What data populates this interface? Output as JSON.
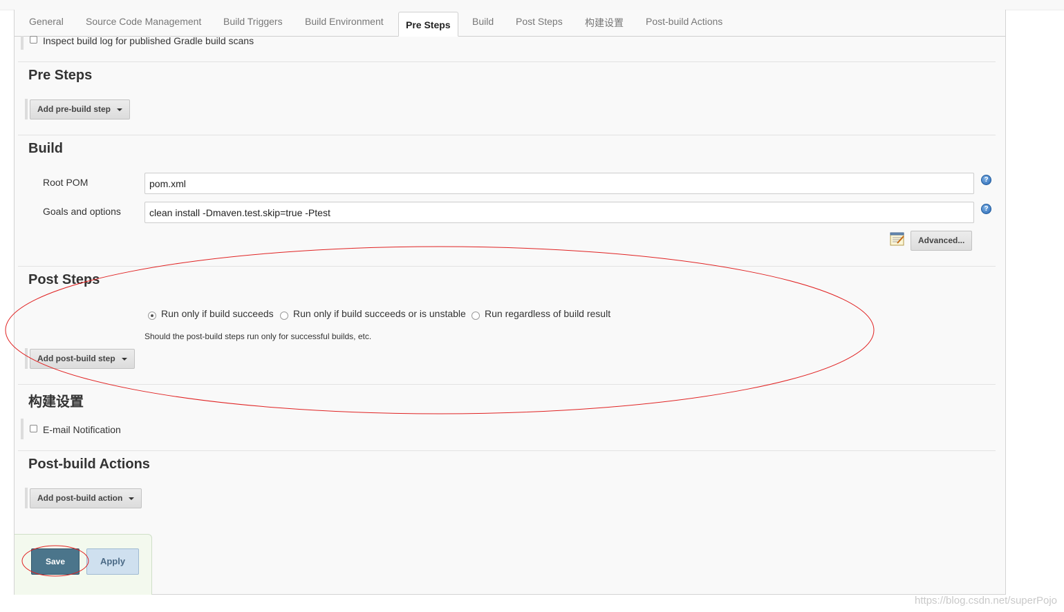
{
  "tabs": [
    "General",
    "Source Code Management",
    "Build Triggers",
    "Build Environment",
    "Pre Steps",
    "Build",
    "Post Steps",
    "构建设置",
    "Post-build Actions"
  ],
  "active_tab": "Pre Steps",
  "gradle": {
    "inspect_label": "Inspect build log for published Gradle build scans"
  },
  "pre_steps": {
    "title": "Pre Steps",
    "add_button": "Add pre-build step"
  },
  "build": {
    "title": "Build",
    "root_pom_label": "Root POM",
    "root_pom_value": "pom.xml",
    "goals_label": "Goals and options",
    "goals_value": "clean install -Dmaven.test.skip=true -Ptest",
    "help_glyph": "?",
    "advanced_button": "Advanced..."
  },
  "post_steps": {
    "title": "Post Steps",
    "options": [
      "Run only if build succeeds",
      "Run only if build succeeds or is unstable",
      "Run regardless of build result"
    ],
    "selected_index": 0,
    "help_text": "Should the post-build steps run only for successful builds, etc.",
    "add_button": "Add post-build step"
  },
  "build_settings": {
    "title": "构建设置",
    "email_label": "E-mail Notification"
  },
  "post_build_actions": {
    "title": "Post-build Actions",
    "add_button": "Add post-build action"
  },
  "footer": {
    "save": "Save",
    "apply": "Apply"
  },
  "watermark": "https://blog.csdn.net/superPojo",
  "colors": {
    "annotation_red": "#e02020",
    "save_bg": "#4b758b",
    "apply_bg": "#cfe0ef"
  }
}
